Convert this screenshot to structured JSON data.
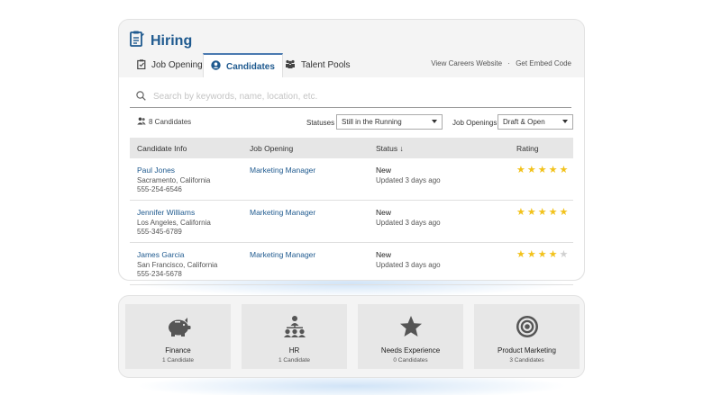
{
  "app": {
    "title": "Hiring"
  },
  "tabs": [
    {
      "label": "Job Openings",
      "icon": "clipboard-icon"
    },
    {
      "label": "Candidates",
      "icon": "user-circle-icon",
      "active": true
    },
    {
      "label": "Talent Pools",
      "icon": "group-icon"
    }
  ],
  "header_links": {
    "careers": "View Careers Website",
    "separator": "·",
    "embed": "Get Embed Code"
  },
  "search": {
    "placeholder": "Search by keywords, name, location, etc."
  },
  "candidate_count": "8 Candidates",
  "filters": {
    "statuses_label": "Statuses",
    "statuses_value": "Still in the Running",
    "job_openings_label": "Job Openings",
    "job_openings_value": "Draft & Open"
  },
  "table": {
    "headers": {
      "info": "Candidate Info",
      "job": "Job Opening",
      "status": "Status",
      "status_sort": "↓",
      "rating": "Rating"
    },
    "rows": [
      {
        "name": "Paul Jones",
        "location": "Sacramento, California",
        "phone": "555-254-6546",
        "job": "Marketing Manager",
        "status": "New",
        "updated": "Updated 3 days ago",
        "rating": 5
      },
      {
        "name": "Jennifer Williams",
        "location": "Los Angeles, California",
        "phone": "555-345-6789",
        "job": "Marketing Manager",
        "status": "New",
        "updated": "Updated 3 days ago",
        "rating": 5
      },
      {
        "name": "James Garcia",
        "location": "San Francisco, California",
        "phone": "555-234-5678",
        "job": "Marketing Manager",
        "status": "New",
        "updated": "Updated 3 days ago",
        "rating": 4
      }
    ]
  },
  "talent_pools": [
    {
      "name": "Finance",
      "count": "1 Candidate",
      "icon": "piggy-bank-icon"
    },
    {
      "name": "HR",
      "count": "1 Candidate",
      "icon": "org-chart-icon"
    },
    {
      "name": "Needs Experience",
      "count": "0 Candidates",
      "icon": "star-icon"
    },
    {
      "name": "Product Marketing",
      "count": "3 Candidates",
      "icon": "target-icon"
    }
  ],
  "colors": {
    "accent": "#1f5a8f",
    "star_on": "#f2c21b",
    "star_off": "#d0d0d0",
    "pool_icon": "#555555"
  }
}
